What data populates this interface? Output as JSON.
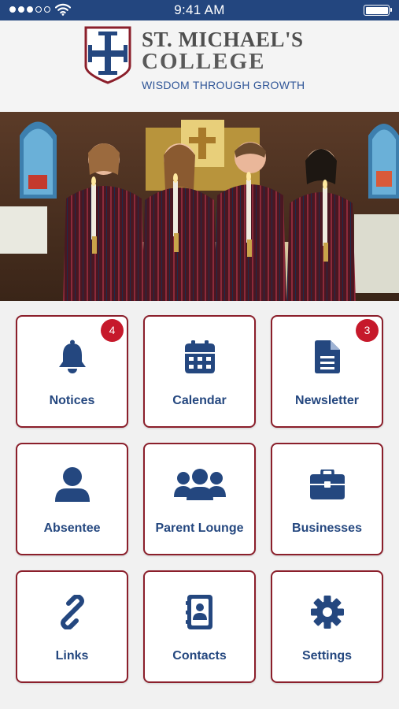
{
  "status_bar": {
    "time": "9:41 AM",
    "signal_icon": "signal-dots-icon",
    "wifi_icon": "wifi-icon",
    "battery_icon": "battery-icon",
    "color": "#23467f"
  },
  "header": {
    "logo_icon": "crest-cross-icon",
    "school_name_line1": "ST. MICHAEL'S",
    "school_name_line2": "COLLEGE",
    "motto": "WISDOM THROUGH GROWTH"
  },
  "hero": {
    "image": "students-holding-candles-in-chapel"
  },
  "menu": {
    "tiles": [
      {
        "label": "Notices",
        "icon": "bell-icon",
        "badge": "4"
      },
      {
        "label": "Calendar",
        "icon": "calendar-icon",
        "badge": ""
      },
      {
        "label": "Newsletter",
        "icon": "document-icon",
        "badge": "3"
      },
      {
        "label": "Absentee",
        "icon": "person-icon",
        "badge": ""
      },
      {
        "label": "Parent Lounge",
        "icon": "group-icon",
        "badge": ""
      },
      {
        "label": "Businesses",
        "icon": "briefcase-icon",
        "badge": ""
      },
      {
        "label": "Links",
        "icon": "link-icon",
        "badge": ""
      },
      {
        "label": "Contacts",
        "icon": "address-book-icon",
        "badge": ""
      },
      {
        "label": "Settings",
        "icon": "gear-icon",
        "badge": ""
      }
    ]
  },
  "colors": {
    "brand_blue": "#24477f",
    "tile_border": "#8b1f2b",
    "badge_red": "#c6192b"
  }
}
